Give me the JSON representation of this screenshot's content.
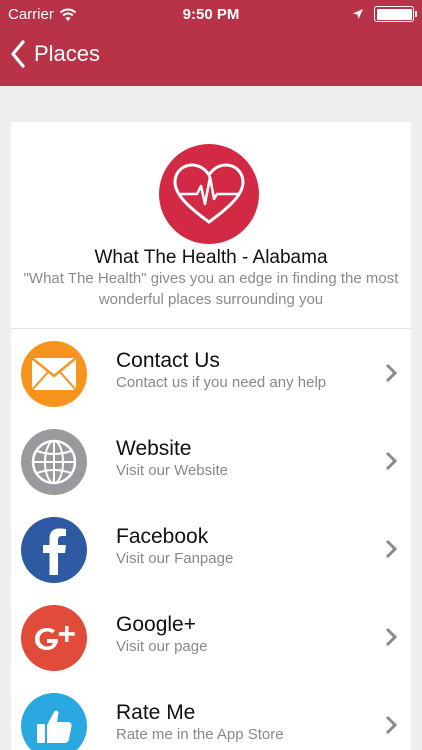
{
  "status_bar": {
    "carrier": "Carrier",
    "time": "9:50 PM"
  },
  "nav": {
    "back_label": "Places"
  },
  "header_card": {
    "title": "What The Health - Alabama",
    "description": "\"What The Health\" gives you an edge in finding the most wonderful places surrounding you"
  },
  "items": [
    {
      "title": "Contact Us",
      "subtitle": "Contact us if you need any help",
      "icon": "envelope-icon",
      "color": "#f7941d"
    },
    {
      "title": "Website",
      "subtitle": "Visit our Website",
      "icon": "globe-icon",
      "color": "#9a9a9e"
    },
    {
      "title": "Facebook",
      "subtitle": "Visit our Fanpage",
      "icon": "facebook-icon",
      "color": "#2d5aa3"
    },
    {
      "title": "Google+",
      "subtitle": "Visit our page",
      "icon": "google-plus-icon",
      "color": "#e04b3a"
    },
    {
      "title": "Rate Me",
      "subtitle": "Rate me in the App Store",
      "icon": "thumbs-up-icon",
      "color": "#29a9e0"
    }
  ],
  "colors": {
    "navbar": "#b83248",
    "logo": "#d22a45",
    "background": "#efeff1"
  }
}
